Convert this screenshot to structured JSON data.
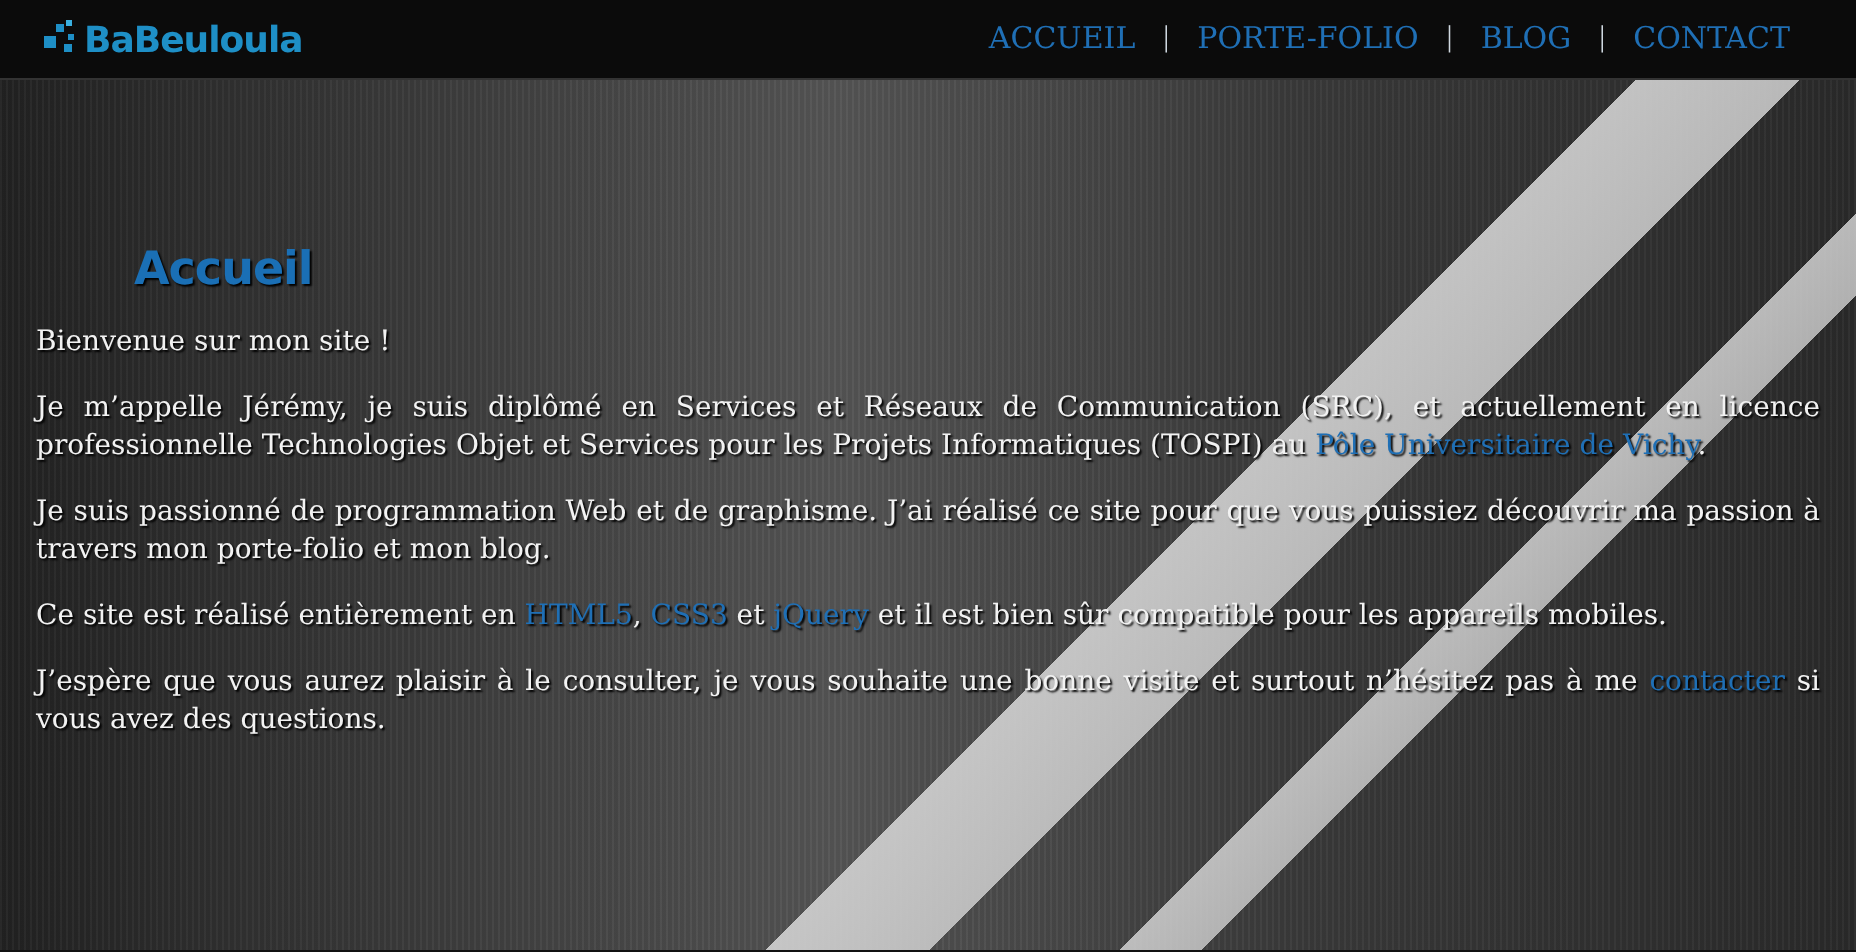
{
  "logo": {
    "text": "BaBeuloula"
  },
  "nav": {
    "separator": "|",
    "items": [
      {
        "label": "ACCUEIL"
      },
      {
        "label": "PORTE-FOLIO"
      },
      {
        "label": "BLOG"
      },
      {
        "label": "CONTACT"
      }
    ]
  },
  "heading": "Accueil",
  "paragraphs": [
    [
      {
        "text": "Bienvenue sur mon site !",
        "link": false
      }
    ],
    [
      {
        "text": "Je m’appelle Jérémy, je suis diplômé en Services et Réseaux de Communication (SRC), et actuellement en licence professionnelle Technologies Objet et Services pour les Projets Informatiques (TOSPI) au ",
        "link": false
      },
      {
        "text": "Pôle Universitaire de Vichy",
        "link": true
      },
      {
        "text": ".",
        "link": false
      }
    ],
    [
      {
        "text": "Je suis passionné de programmation Web et de graphisme. J’ai réalisé ce site pour que vous puissiez découvrir ma passion à travers mon porte-folio et mon blog.",
        "link": false
      }
    ],
    [
      {
        "text": "Ce site est réalisé entièrement en ",
        "link": false
      },
      {
        "text": "HTML5",
        "link": true
      },
      {
        "text": ", ",
        "link": false
      },
      {
        "text": "CSS3",
        "link": true
      },
      {
        "text": " et ",
        "link": false
      },
      {
        "text": "jQuery",
        "link": true
      },
      {
        "text": " et il est bien sûr compatible pour les appareils mobiles.",
        "link": false
      }
    ],
    [
      {
        "text": "J’espère que vous aurez plaisir à le consulter, je vous souhaite une bonne visite et surtout n’hésitez pas à me ",
        "link": false
      },
      {
        "text": "contacter",
        "link": true
      },
      {
        "text": " si vous avez des questions.",
        "link": false
      }
    ]
  ]
}
